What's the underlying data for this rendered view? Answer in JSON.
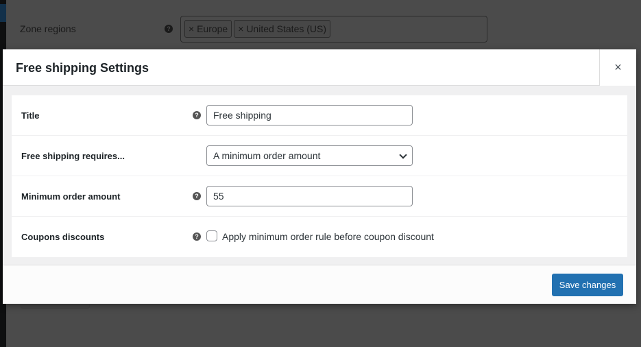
{
  "background": {
    "zone_regions_label": "Zone regions",
    "regions": [
      "Europe",
      "United States (US)"
    ],
    "chip_remove": "×"
  },
  "modal": {
    "title": "Free shipping Settings",
    "close": "×",
    "fields": {
      "title": {
        "label": "Title",
        "value": "Free shipping"
      },
      "requires": {
        "label": "Free shipping requires...",
        "value": "A minimum order amount"
      },
      "min_amount": {
        "label": "Minimum order amount",
        "value": "55"
      },
      "coupons": {
        "label": "Coupons discounts",
        "checkbox_label": "Apply minimum order rule before coupon discount",
        "checked": false
      }
    },
    "help_glyph": "?",
    "save_label": "Save changes"
  },
  "colors": {
    "accent": "#2271b1",
    "overlay": "#4b4b4b"
  }
}
